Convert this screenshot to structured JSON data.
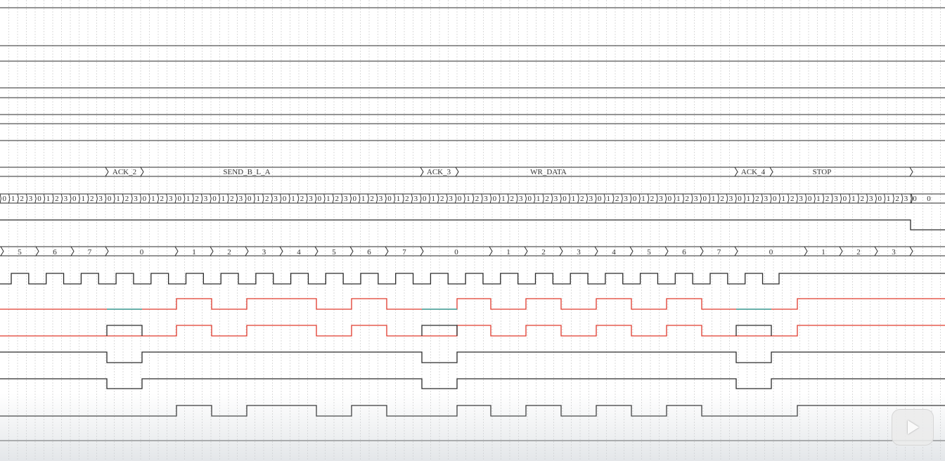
{
  "viewer": {
    "play_button": {
      "icon": "play-icon"
    }
  },
  "colors": {
    "line": "#2a2a2a",
    "grid": "#c4c4c4",
    "sda_out": "#e03a2c",
    "sda_highz": "#3aa7a0"
  },
  "state_labels": [
    "ACK_2",
    "SEND_B_L_A",
    "ACK_3",
    "WR_DATA",
    "ACK_4",
    "STOP"
  ],
  "phase_count_labels": [
    "0",
    "1",
    "2",
    "3"
  ],
  "phase_count_final": "0",
  "bit_count_labels": [
    "5",
    "6",
    "7",
    "0",
    "1",
    "2",
    "3",
    "4",
    "5",
    "6",
    "7",
    "0",
    "1",
    "2",
    "3",
    "4",
    "5",
    "6",
    "7",
    "0",
    "1",
    "2",
    "3"
  ]
}
